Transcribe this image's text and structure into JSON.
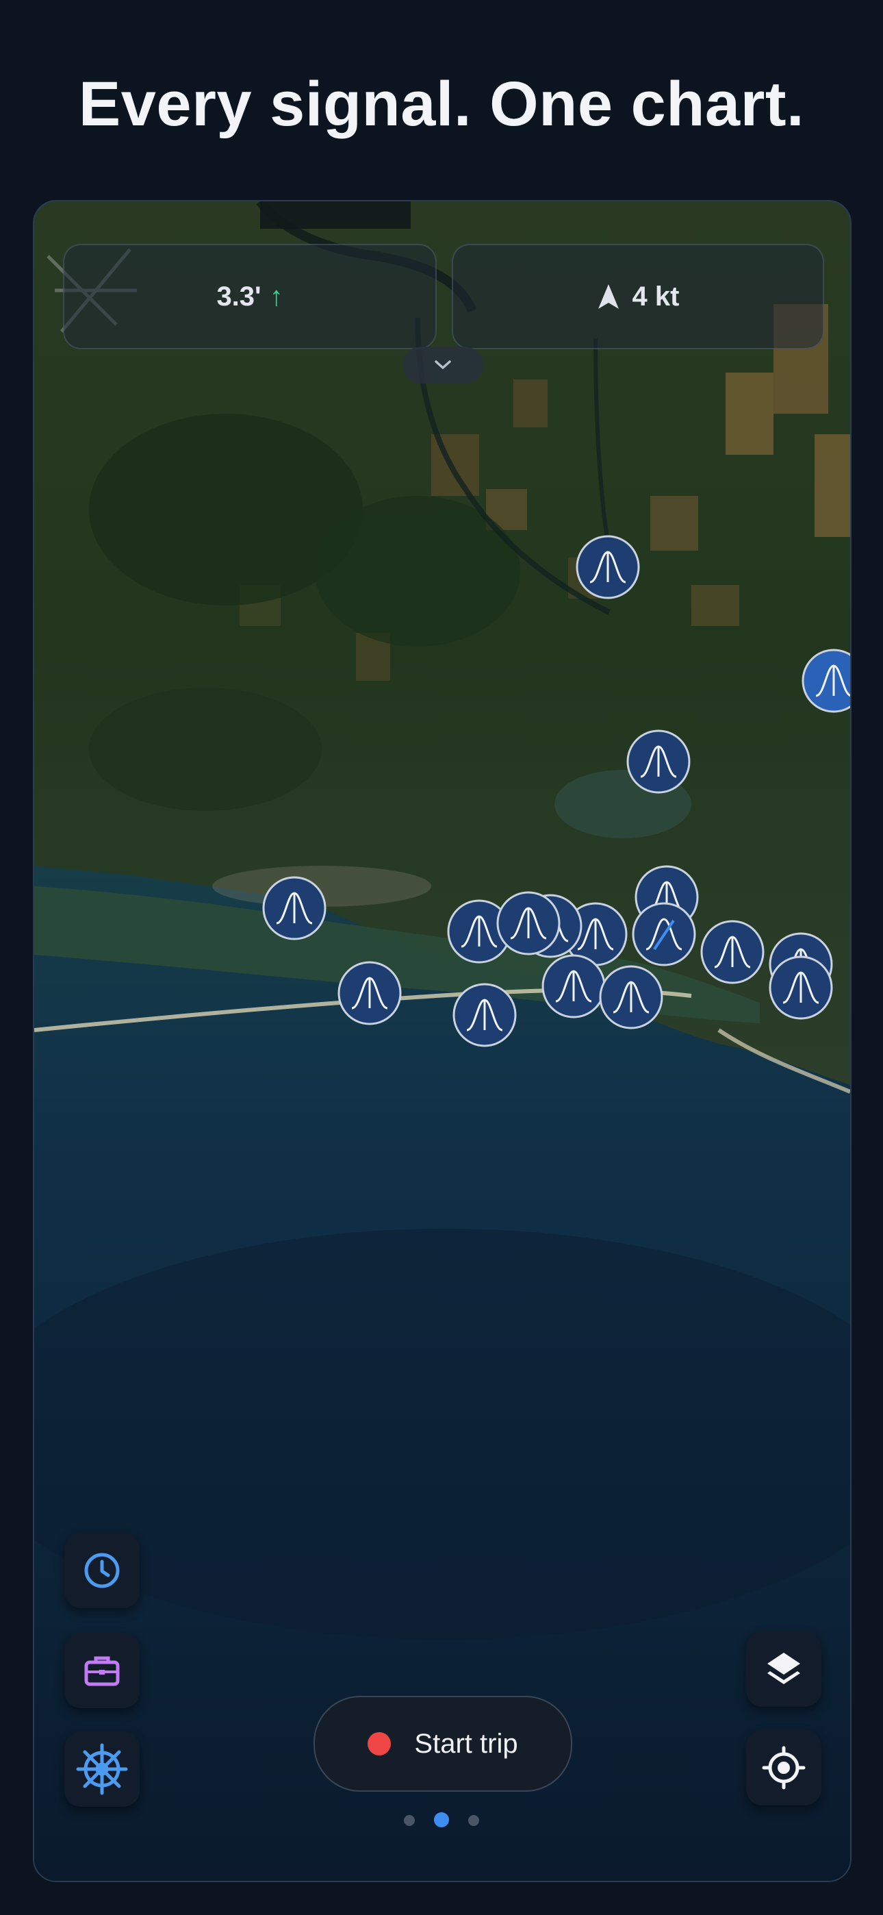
{
  "headline": "Every signal. One chart.",
  "hud": {
    "tide_value": "3.3'",
    "tide_trend_symbol": "↑",
    "speed_value": "4 kt",
    "speed_icon": "navigation-arrow-icon",
    "collapse_icon": "chevron-down-icon"
  },
  "map": {
    "type": "satellite",
    "marker_icon": "tide-station-icon"
  },
  "controls": {
    "left_icons": [
      "clock-icon",
      "briefcase-icon",
      "ships-wheel-icon"
    ],
    "right_icons": [
      "layers-icon",
      "locate-icon"
    ],
    "start_trip_label": "Start trip"
  },
  "pagination": {
    "count": 3,
    "active": 2
  },
  "colors": {
    "accent_blue": "#3d8ef0",
    "tide_up_green": "#2fd48d",
    "record_red": "#f04646",
    "briefcase_purple": "#c07cf0",
    "marker_fill": "#1e4a86"
  }
}
